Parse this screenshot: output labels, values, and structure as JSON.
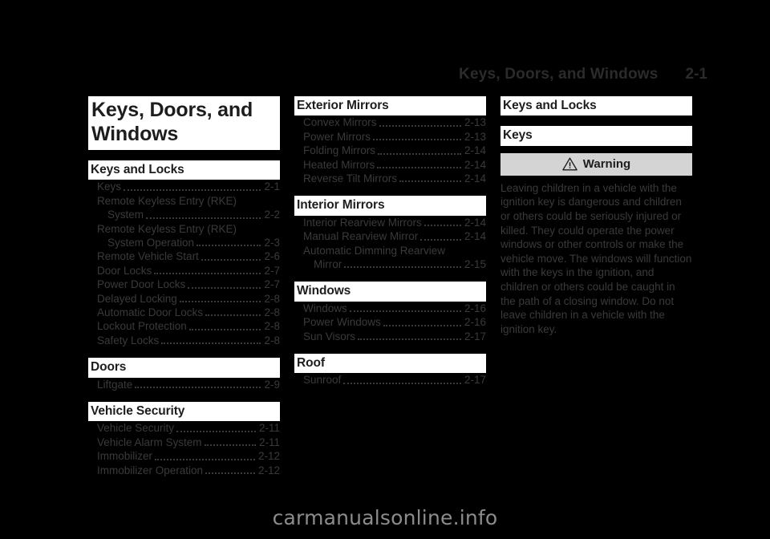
{
  "header": {
    "title": "Keys, Doors, and Windows",
    "page_number": "2-1"
  },
  "chapter": {
    "title": "Keys, Doors, and Windows"
  },
  "columns": {
    "left": [
      {
        "heading": "Keys and Locks",
        "entries": [
          {
            "label": "Keys",
            "page": "2-1"
          },
          {
            "label": "Remote Keyless Entry (RKE)",
            "page": "",
            "wrap": true
          },
          {
            "label": "System",
            "page": "2-2",
            "indent": true
          },
          {
            "label": "Remote Keyless Entry (RKE)",
            "page": "",
            "wrap": true
          },
          {
            "label": "System Operation",
            "page": "2-3",
            "indent": true
          },
          {
            "label": "Remote Vehicle Start",
            "page": "2-6"
          },
          {
            "label": "Door Locks",
            "page": "2-7"
          },
          {
            "label": "Power Door Locks",
            "page": "2-7"
          },
          {
            "label": "Delayed Locking",
            "page": "2-8"
          },
          {
            "label": "Automatic Door Locks",
            "page": "2-8"
          },
          {
            "label": "Lockout Protection",
            "page": "2-8"
          },
          {
            "label": "Safety Locks",
            "page": "2-8"
          }
        ]
      },
      {
        "heading": "Doors",
        "entries": [
          {
            "label": "Liftgate",
            "page": "2-9"
          }
        ]
      },
      {
        "heading": "Vehicle Security",
        "entries": [
          {
            "label": "Vehicle Security",
            "page": "2-11"
          },
          {
            "label": "Vehicle Alarm System",
            "page": "2-11"
          },
          {
            "label": "Immobilizer",
            "page": "2-12"
          },
          {
            "label": "Immobilizer Operation",
            "page": "2-12"
          }
        ]
      }
    ],
    "middle": [
      {
        "heading": "Exterior Mirrors",
        "entries": [
          {
            "label": "Convex Mirrors",
            "page": "2-13"
          },
          {
            "label": "Power Mirrors",
            "page": "2-13"
          },
          {
            "label": "Folding Mirrors",
            "page": "2-14"
          },
          {
            "label": "Heated Mirrors",
            "page": "2-14"
          },
          {
            "label": "Reverse Tilt Mirrors",
            "page": "2-14"
          }
        ]
      },
      {
        "heading": "Interior Mirrors",
        "entries": [
          {
            "label": "Interior Rearview Mirrors",
            "page": "2-14"
          },
          {
            "label": "Manual Rearview Mirror",
            "page": "2-14"
          },
          {
            "label": "Automatic Dimming Rearview",
            "page": "",
            "wrap": true
          },
          {
            "label": "Mirror",
            "page": "2-15",
            "indent": true
          }
        ]
      },
      {
        "heading": "Windows",
        "entries": [
          {
            "label": "Windows",
            "page": "2-16"
          },
          {
            "label": "Power Windows",
            "page": "2-16"
          },
          {
            "label": "Sun Visors",
            "page": "2-17"
          }
        ]
      },
      {
        "heading": "Roof",
        "entries": [
          {
            "label": "Sunroof",
            "page": "2-17"
          }
        ]
      }
    ],
    "right": {
      "section_heading": "Keys and Locks",
      "sub_heading": "Keys",
      "warning": {
        "icon": "warning-triangle-icon",
        "label": "Warning",
        "body": "Leaving children in a vehicle with the ignition key is dangerous and children or others could be seriously injured or killed. They could operate the power windows or other controls or make the vehicle move. The windows will function with the keys in the ignition, and children or others could be caught in the path of a closing window. Do not leave children in a vehicle with the ignition key."
      }
    }
  },
  "watermark": "carmanualsonline.info",
  "colors": {
    "page_background": "#000000",
    "heading_block": "#ffffff",
    "body_text": "#3a3a3a",
    "heading_text": "#1d1d1d",
    "warning_bar": "#d4d4d4",
    "watermark_text": "#8c8c8c"
  }
}
